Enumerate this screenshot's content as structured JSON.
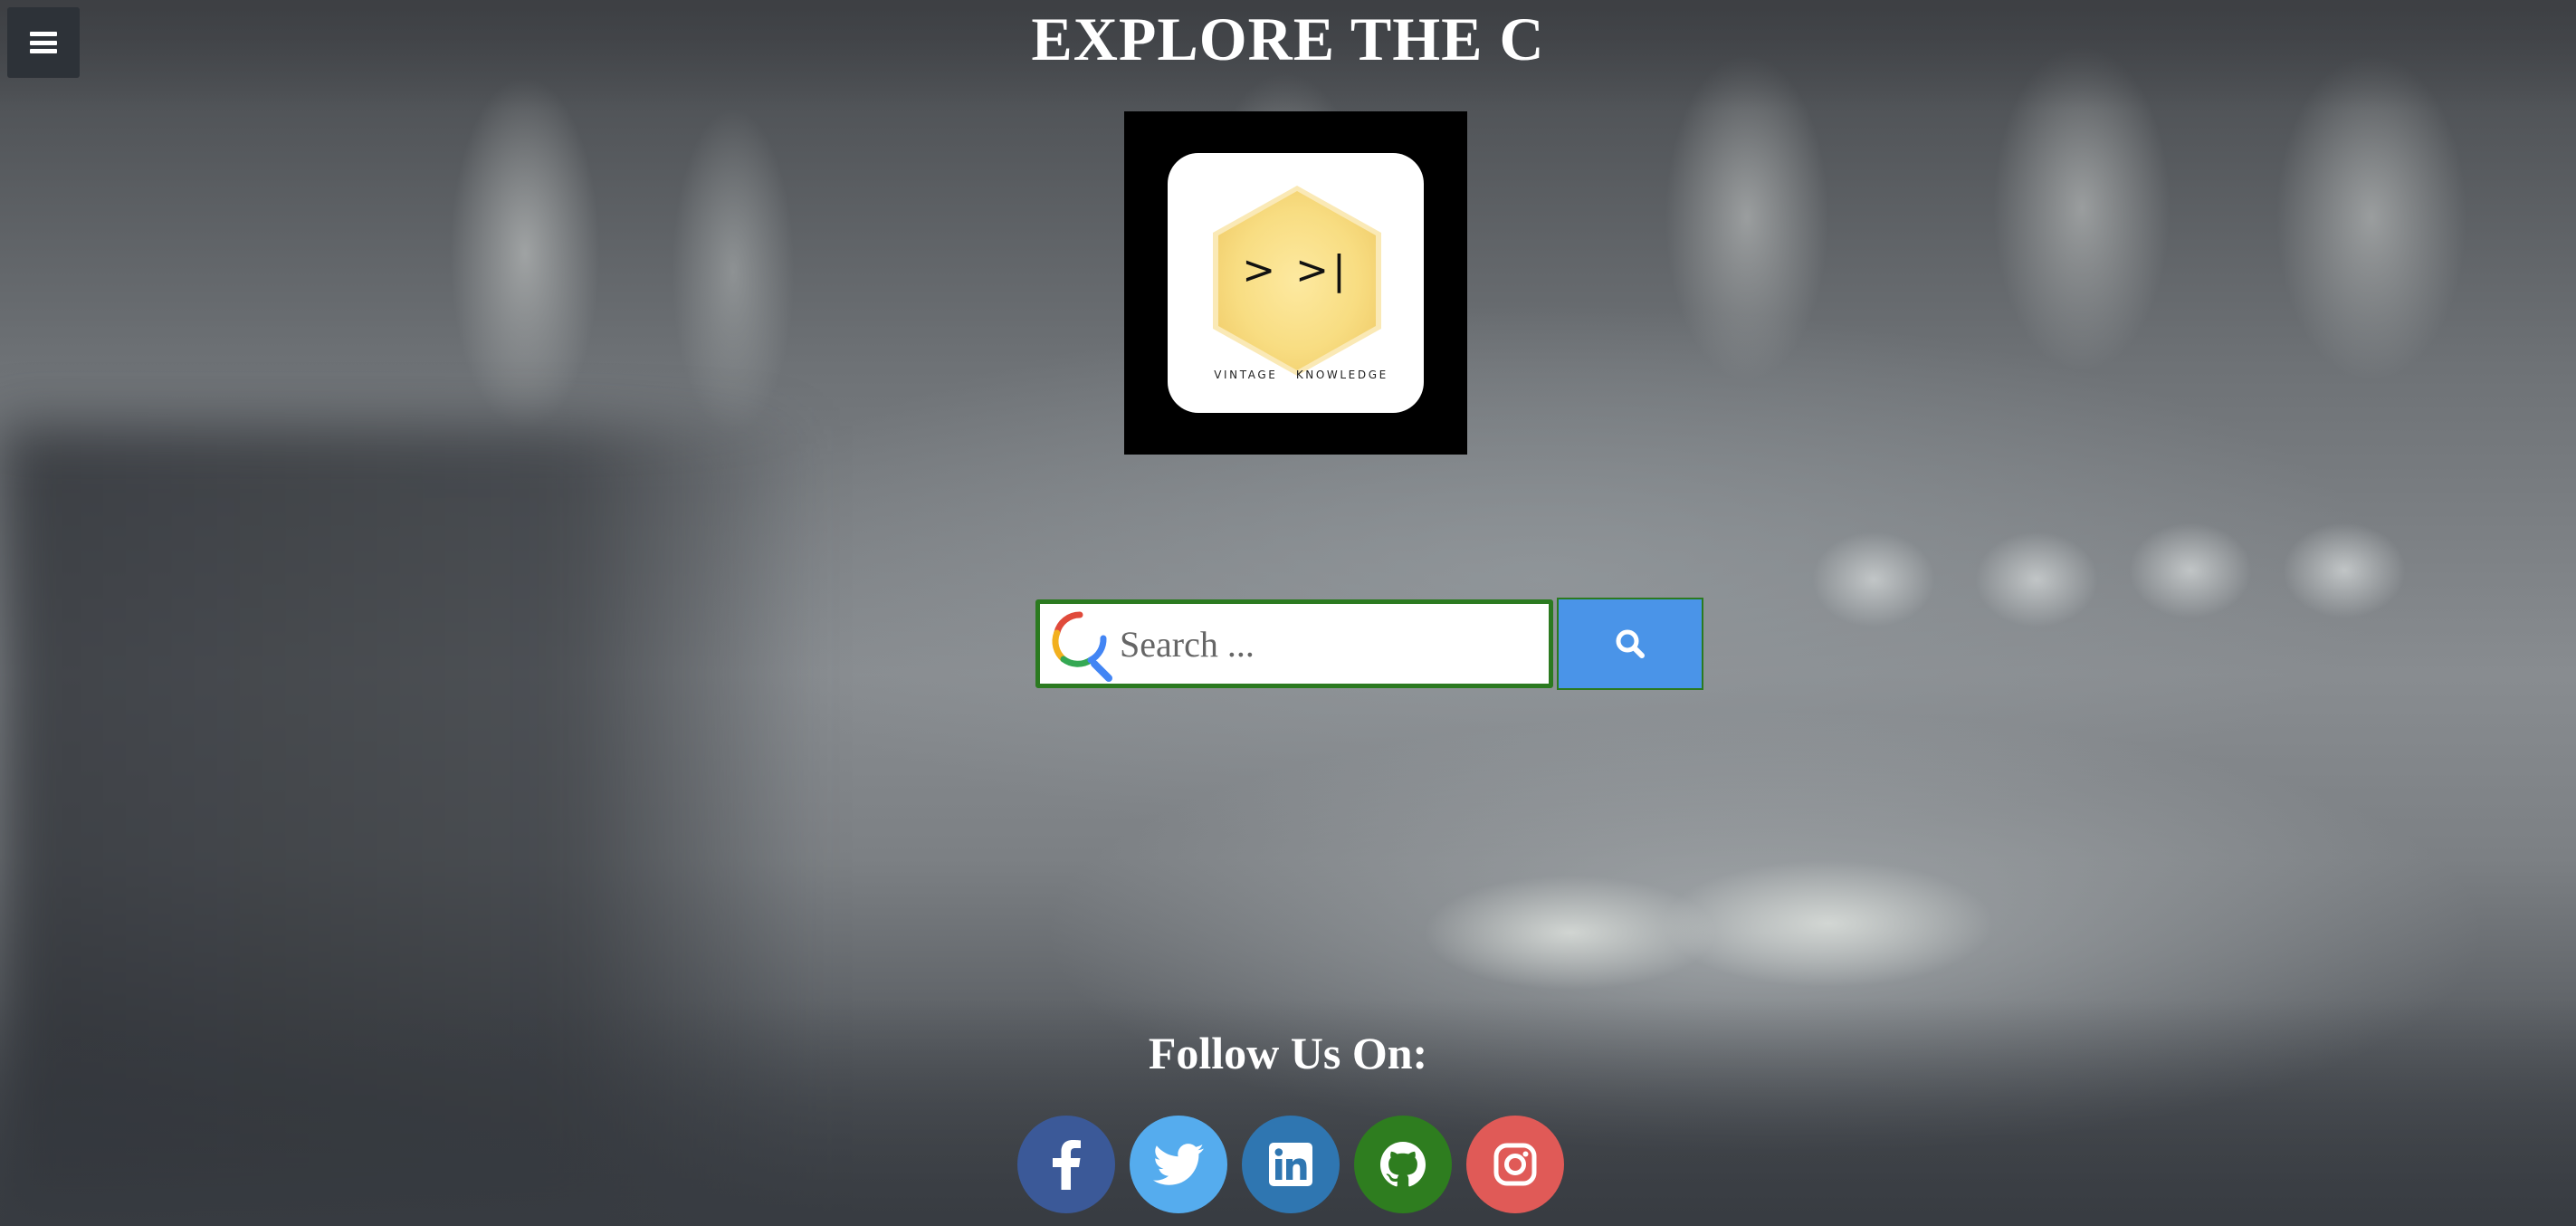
{
  "colors": {
    "menu_bg": "#2d3238",
    "search_border": "#2b7a20",
    "search_button": "#4a94e8",
    "facebook": "#3b5998",
    "twitter": "#55acee",
    "linkedin": "#2f76b1",
    "github": "#2e7d1f",
    "instagram": "#e05a57"
  },
  "header": {
    "menu_icon": "hamburger-icon",
    "title": "EXPLORE THE C"
  },
  "logo": {
    "prompt": "> >|",
    "tagline": "VINTAGE KNOWLEDGE"
  },
  "search": {
    "placeholder": "Search ...",
    "value": "",
    "button_icon": "search-icon"
  },
  "follow": {
    "title": "Follow Us On:",
    "links": [
      {
        "name": "facebook",
        "icon": "facebook-icon"
      },
      {
        "name": "twitter",
        "icon": "twitter-icon"
      },
      {
        "name": "linkedin",
        "icon": "linkedin-icon"
      },
      {
        "name": "github",
        "icon": "github-icon"
      },
      {
        "name": "instagram",
        "icon": "instagram-icon"
      }
    ]
  }
}
